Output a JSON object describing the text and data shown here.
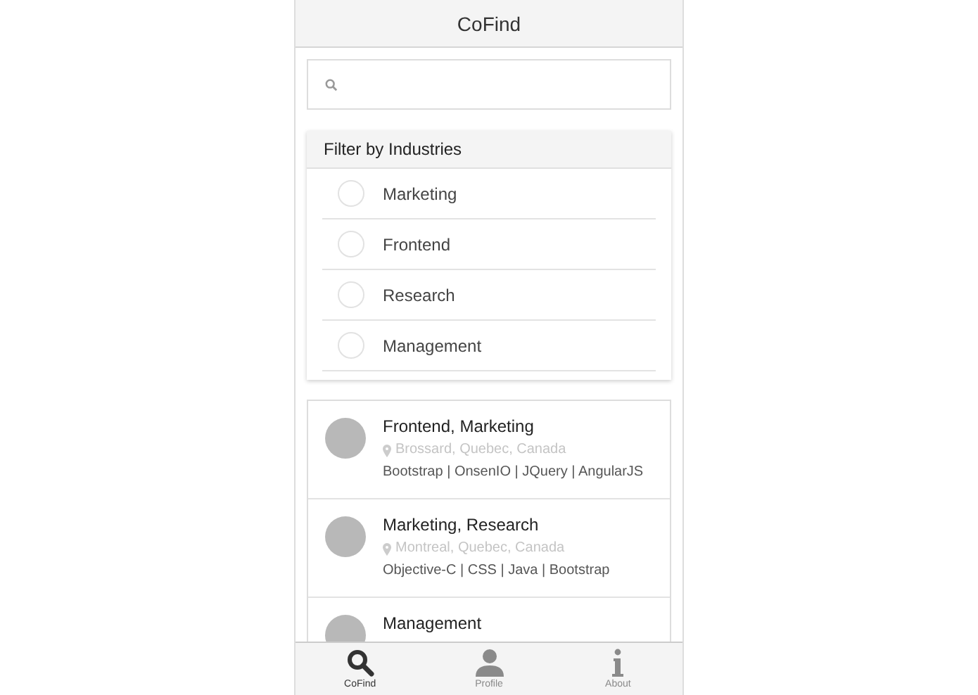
{
  "header": {
    "title": "CoFind"
  },
  "filter": {
    "title": "Filter by Industries",
    "items": [
      {
        "label": "Marketing",
        "selected": false
      },
      {
        "label": "Frontend",
        "selected": false
      },
      {
        "label": "Research",
        "selected": false
      },
      {
        "label": "Management",
        "selected": false
      }
    ]
  },
  "people": [
    {
      "title": "Frontend, Marketing",
      "location": "Brossard, Quebec, Canada",
      "skills": "Bootstrap | OnsenIO | JQuery | AngularJS"
    },
    {
      "title": "Marketing, Research",
      "location": "Montreal, Quebec, Canada",
      "skills": "Objective-C | CSS | Java | Bootstrap"
    },
    {
      "title": "Management"
    }
  ],
  "tabs": [
    {
      "label": "CoFind",
      "kind": "search",
      "selected": true
    },
    {
      "label": "Profile",
      "kind": "person",
      "selected": false
    },
    {
      "label": "About",
      "kind": "info",
      "selected": false
    }
  ]
}
